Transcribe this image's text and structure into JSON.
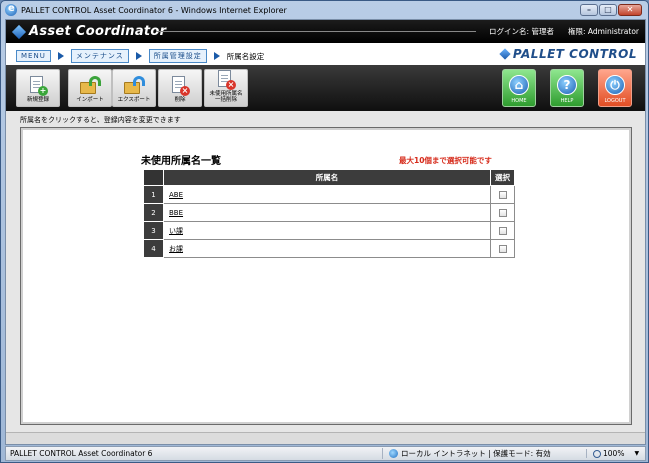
{
  "window": {
    "title": "PALLET CONTROL Asset Coordinator 6 - Windows Internet Explorer",
    "buttons": [
      "–",
      "□",
      "✕"
    ]
  },
  "header": {
    "app_name": "Asset Coordinator",
    "login_label": "ログイン名: 管理者",
    "role_label": "権限: Administrator"
  },
  "breadcrumb": {
    "items": [
      "MENU",
      "メンテナンス",
      "所属管理設定"
    ],
    "current": "所属名設定"
  },
  "brand": {
    "name": "PALLET CONTROL"
  },
  "toolbar": {
    "buttons": [
      {
        "label": "新規登録",
        "icon": "new-document-icon"
      },
      {
        "label": "インポート",
        "icon": "import-icon"
      },
      {
        "label": "エクスポート",
        "icon": "export-icon"
      },
      {
        "label": "削除",
        "icon": "delete-icon"
      },
      {
        "label": "未使用所属名\n一括削除",
        "icon": "bulk-delete-icon"
      }
    ],
    "right_buttons": [
      {
        "label": "HOME",
        "icon": "home-icon",
        "glyph": "⌂"
      },
      {
        "label": "HELP",
        "icon": "help-icon",
        "glyph": "?"
      },
      {
        "label": "LOGOUT",
        "icon": "logout-icon",
        "glyph": "⏻"
      }
    ]
  },
  "main": {
    "hint": "所属名をクリックすると、登録内容を変更できます",
    "title": "未使用所属名一覧",
    "note": "最大10個まで選択可能です",
    "columns": [
      "所属名",
      "選択"
    ],
    "rows": [
      {
        "num": "1",
        "name": "ABE"
      },
      {
        "num": "2",
        "name": "BBE"
      },
      {
        "num": "3",
        "name": "い課"
      },
      {
        "num": "4",
        "name": "お課"
      }
    ]
  },
  "statusbar": {
    "left": "PALLET CONTROL Asset Coordinator 6",
    "zone": "ローカル イントラネット | 保護モード: 有効",
    "zoom": "100%"
  }
}
